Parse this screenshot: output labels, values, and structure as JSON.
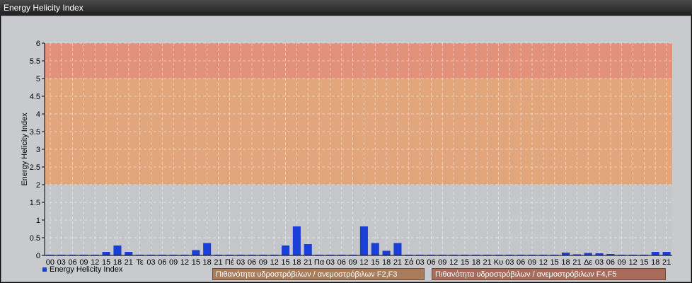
{
  "window": {
    "title": "Energy Helicity Index"
  },
  "chart_data": {
    "type": "bar",
    "ylabel": "Energy Helicity Index",
    "ylim": [
      0,
      6
    ],
    "yticks": [
      "0",
      "0.5",
      "1",
      "1.5",
      "2",
      "2.5",
      "3",
      "3.5",
      "4",
      "4.5",
      "5",
      "5.5",
      "6"
    ],
    "categories": [
      "00",
      "03",
      "06",
      "09",
      "12",
      "15",
      "18",
      "21",
      "Τε",
      "03",
      "06",
      "09",
      "12",
      "15",
      "18",
      "21",
      "Πέ",
      "03",
      "06",
      "09",
      "12",
      "15",
      "18",
      "21",
      "Πα",
      "03",
      "06",
      "09",
      "12",
      "15",
      "18",
      "21",
      "Σά",
      "03",
      "06",
      "09",
      "12",
      "15",
      "18",
      "21",
      "Κυ",
      "03",
      "06",
      "09",
      "12",
      "15",
      "18",
      "21",
      "Δε",
      "03",
      "06",
      "09",
      "12",
      "15",
      "18",
      "21"
    ],
    "series": [
      {
        "name": "Energy Helicity Index",
        "color": "#1a3fd6",
        "values": [
          0,
          0,
          0,
          0,
          0,
          0.1,
          0.28,
          0.1,
          0,
          0,
          0,
          0,
          0,
          0.15,
          0.35,
          0,
          0,
          0,
          0,
          0,
          0,
          0.28,
          0.82,
          0.32,
          0,
          0,
          0,
          0,
          0.82,
          0.35,
          0.13,
          0.35,
          0,
          0,
          0,
          0,
          0,
          0,
          0,
          0,
          0,
          0,
          0,
          0,
          0,
          0,
          0.08,
          0.03,
          0.07,
          0.06,
          0.04,
          0.02,
          0.02,
          0.02,
          0.1,
          0.1
        ]
      }
    ],
    "zones": [
      {
        "from": 2,
        "to": 5,
        "color": "#e3a374",
        "label": "Πιθανότητα υδροστρόβιλων / ανεμοστρόβιλων F2,F3"
      },
      {
        "from": 5,
        "to": 6,
        "color": "#e48c74",
        "label": "Πιθανότητα υδροστρόβιλων / ανεμοστρόβιλων F4,F5"
      }
    ],
    "grid": true,
    "legend": "bottom-left"
  }
}
